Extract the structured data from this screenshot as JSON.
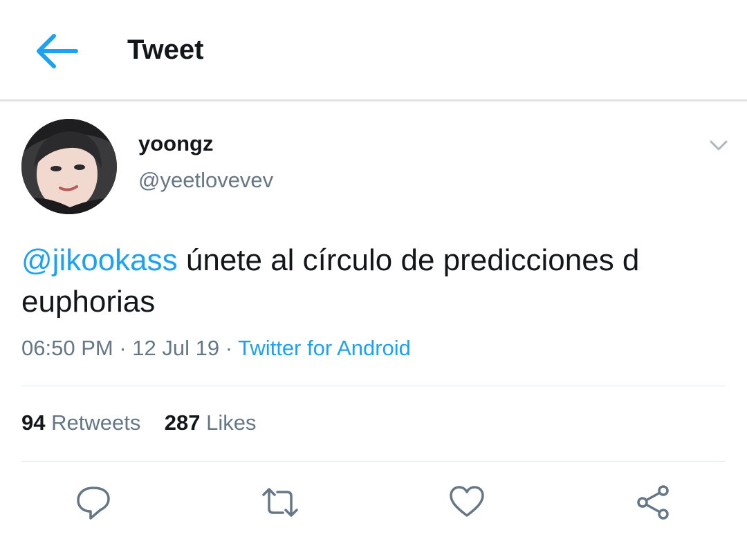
{
  "header": {
    "title": "Tweet",
    "back_icon": "arrow-left-icon",
    "accent": "#1da1f2"
  },
  "tweet": {
    "author": {
      "display_name": "yoongz",
      "handle": "@yeetlovevev"
    },
    "mention": "@jikookass",
    "text": "únete al círculo de predicciones d euphorias",
    "time": "06:50 PM",
    "date": "12 Jul 19",
    "source": "Twitter for Android",
    "retweets_count": "94",
    "retweets_label": "Retweets",
    "likes_count": "287",
    "likes_label": "Likes"
  },
  "actions": {
    "icons": [
      "reply-icon",
      "retweet-icon",
      "like-icon",
      "share-icon"
    ]
  },
  "colors": {
    "text": "#14171a",
    "secondary": "#657786",
    "link": "#1da1f2",
    "divider": "#e1e8ed"
  }
}
